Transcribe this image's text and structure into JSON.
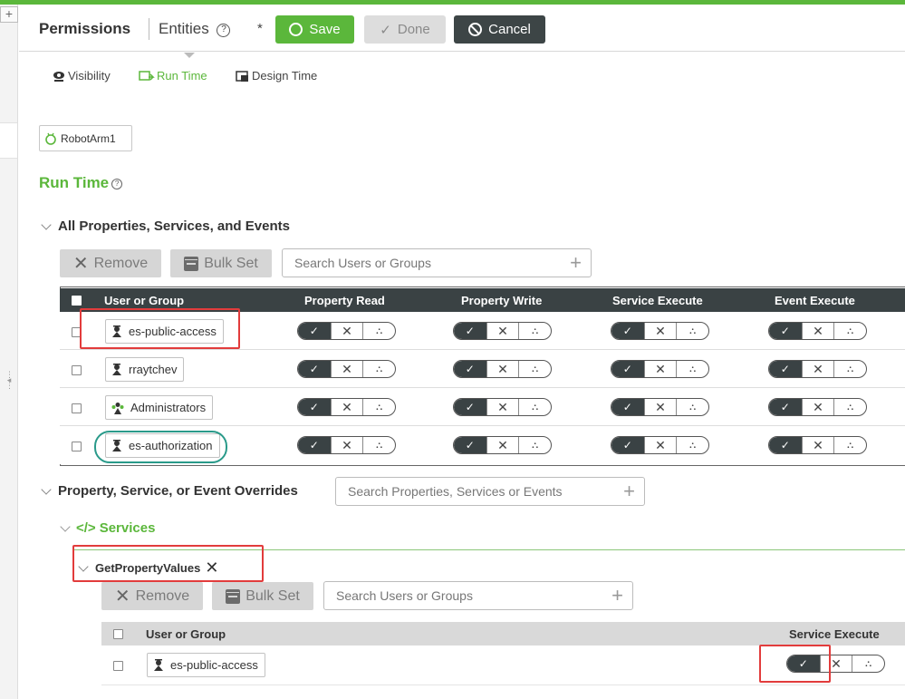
{
  "header": {
    "title": "Permissions",
    "subtitle": "Entities",
    "help_icon": "?",
    "dirty_marker": "*",
    "save_label": "Save",
    "done_label": "Done",
    "cancel_label": "Cancel"
  },
  "tabs": [
    {
      "label": "Visibility",
      "icon": "eye-icon"
    },
    {
      "label": "Run Time",
      "icon": "runtime-icon",
      "active": true
    },
    {
      "label": "Design Time",
      "icon": "design-time-icon"
    }
  ],
  "entity": {
    "name": "RobotArm1",
    "icon": "thing-icon"
  },
  "runtime_heading": "Run Time",
  "all_section": {
    "title": "All Properties, Services, and Events",
    "remove_label": "Remove",
    "bulk_set_label": "Bulk Set",
    "search_placeholder": "Search Users or Groups",
    "columns": [
      "User or Group",
      "Property Read",
      "Property Write",
      "Service Execute",
      "Event Execute"
    ],
    "rows": [
      {
        "name": "es-public-access",
        "type": "user"
      },
      {
        "name": "rraytchev",
        "type": "user"
      },
      {
        "name": "Administrators",
        "type": "group"
      },
      {
        "name": "es-authorization",
        "type": "user"
      }
    ]
  },
  "overrides": {
    "title": "Property, Service, or Event Overrides",
    "search_placeholder": "Search Properties, Services or Events",
    "services_label": "Services",
    "services_icon": "</>",
    "service_name": "GetPropertyValues",
    "remove_label": "Remove",
    "bulk_set_label": "Bulk Set",
    "user_search_placeholder": "Search Users or Groups",
    "columns": [
      "User or Group",
      "Service Execute"
    ],
    "rows": [
      {
        "name": "es-public-access",
        "type": "user"
      }
    ]
  },
  "toggle": {
    "allow": "✓",
    "deny": "✕",
    "inherit": "⛬"
  }
}
